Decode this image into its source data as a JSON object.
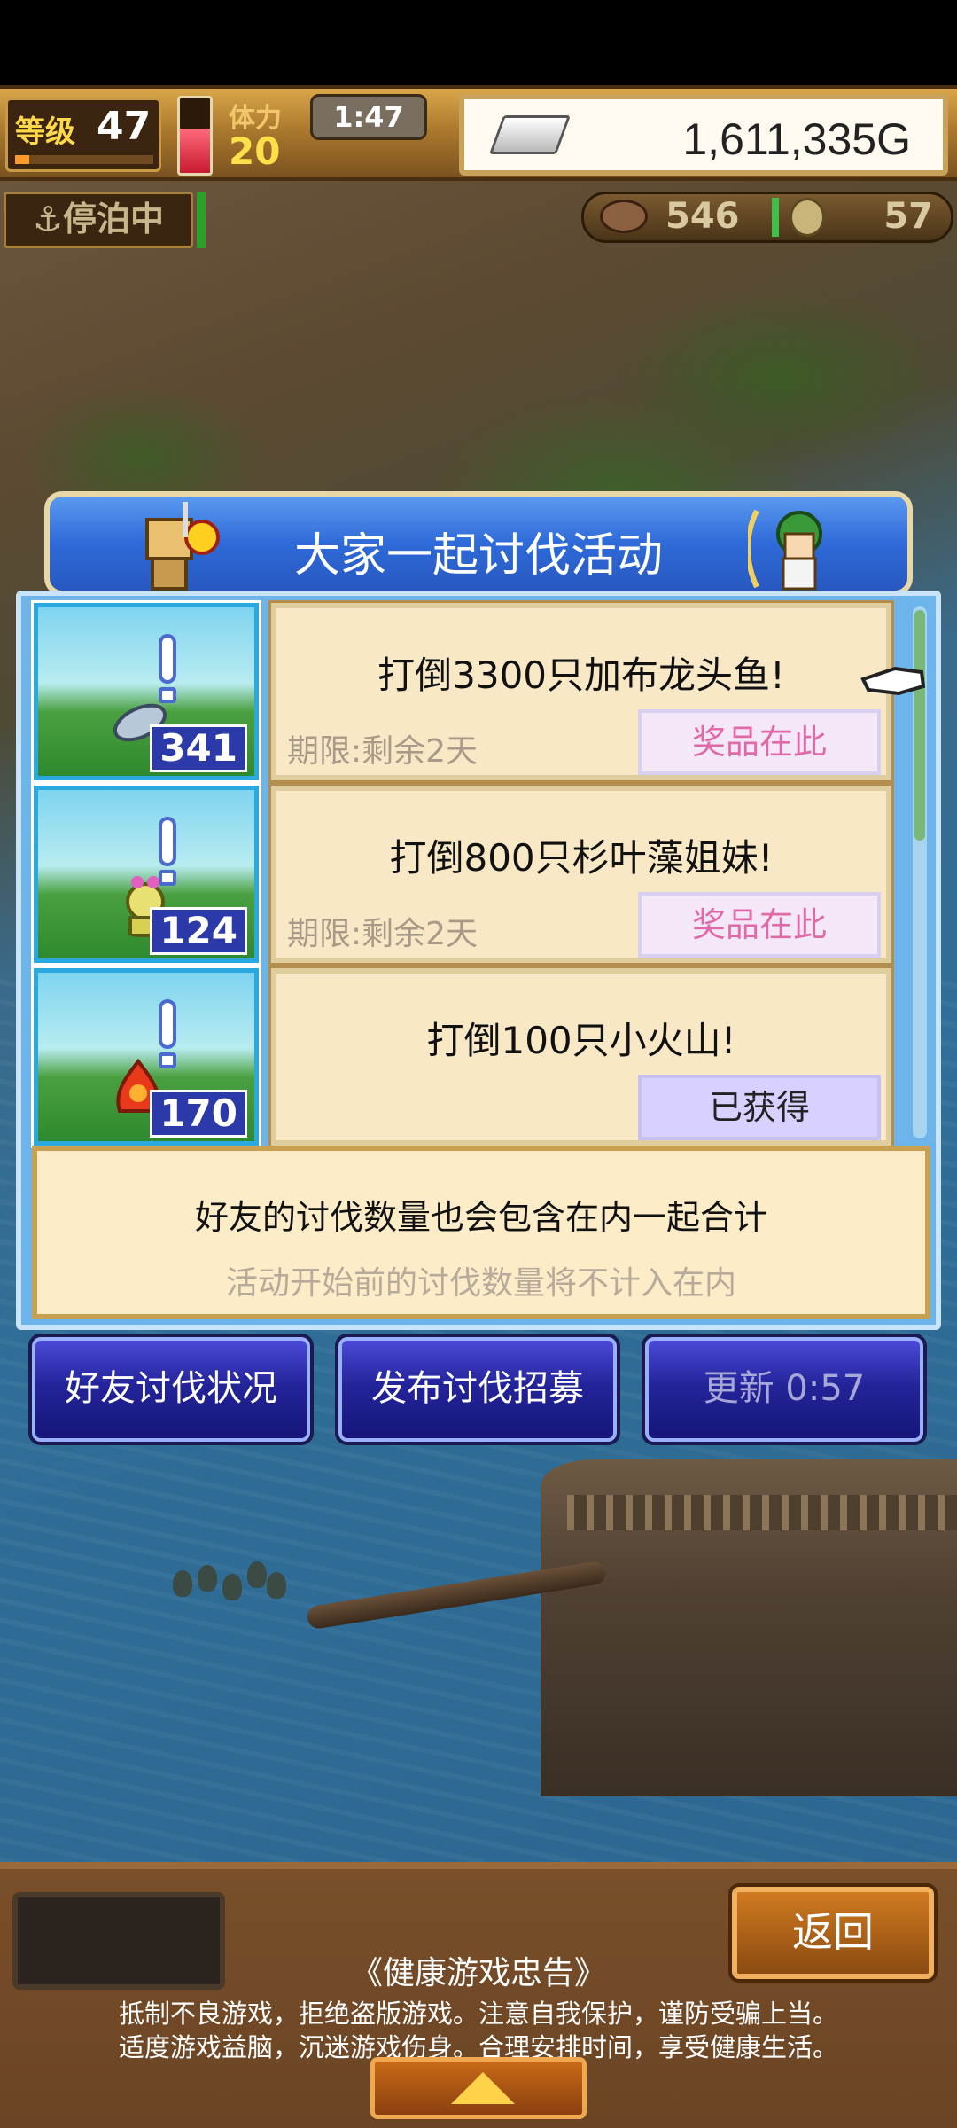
{
  "hud": {
    "level_label": "等级",
    "level_value": "47",
    "level_progress": 0.1,
    "stamina_label": "体力",
    "stamina_value": "20",
    "stamina_fill": 0.6,
    "timer": "1:47",
    "gold": "1,611,335G"
  },
  "status": {
    "dock_label": "停泊中",
    "resource1_value": "546",
    "resource2_value": "57"
  },
  "panel": {
    "title": "大家一起讨伐活动",
    "events": [
      {
        "title": "打倒3300只加布龙头鱼!",
        "deadline": "期限:剩余2天",
        "count": "341",
        "button": "奖品在此",
        "state": "available"
      },
      {
        "title": "打倒800只杉叶藻姐妹!",
        "deadline": "期限:剩余2天",
        "count": "124",
        "button": "奖品在此",
        "state": "available"
      },
      {
        "title": "打倒100只小火山!",
        "deadline": "",
        "count": "170",
        "button": "已获得",
        "state": "obtained"
      }
    ],
    "notice_main": "好友的讨伐数量也会包含在内一起合计",
    "notice_sub": "活动开始前的讨伐数量将不计入在内"
  },
  "buttons": {
    "friends_status": "好友讨伐状况",
    "post_recruit": "发布讨伐招募",
    "refresh": "更新 0:57"
  },
  "footer": {
    "back": "返回",
    "advisory_title": "《健康游戏忠告》",
    "advisory_line1": "抵制不良游戏，拒绝盗版游戏。注意自我保护，谨防受骗上当。",
    "advisory_line2": "适度游戏益脑，沉迷游戏伤身。合理安排时间，享受健康生活。"
  },
  "colors": {
    "panel_blue": "#2e6ad8",
    "prize_text": "#e06aa8",
    "button_blue": "#24249a"
  }
}
